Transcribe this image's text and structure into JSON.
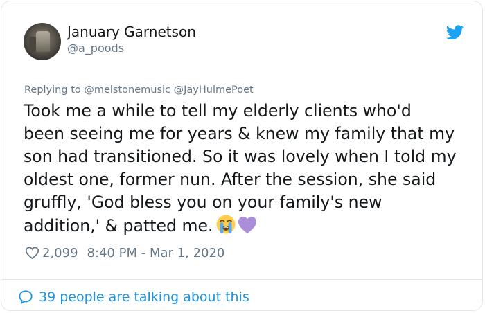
{
  "author": {
    "display_name": "January Garnetson",
    "handle": "@a_poods",
    "avatar_icon": "profile-photo"
  },
  "platform_icon": "twitter-bird-icon",
  "reply_context": "Replying to @melstonemusic @JayHulmePoet",
  "tweet": {
    "lines": [
      "Took me a while to tell my elderly clients who'd",
      "been seeing me for years & knew my family that my",
      "son had transitioned. So it was lovely when I told my",
      "oldest one, former nun. After the session, she said",
      "gruffly, 'God bless you on your family's new",
      "addition,' & patted me."
    ],
    "emojis": [
      "loudly-crying-face",
      "purple-heart"
    ]
  },
  "meta": {
    "like_count": "2,099",
    "timestamp": "8:40 PM - Mar 1, 2020"
  },
  "conversation": {
    "label": "39 people are talking about this"
  },
  "colors": {
    "link_blue": "#1b95e0",
    "muted_gray": "#657786",
    "text": "#14171a",
    "border": "#e1e8ed",
    "purple_heart": "#ab8ed9"
  }
}
